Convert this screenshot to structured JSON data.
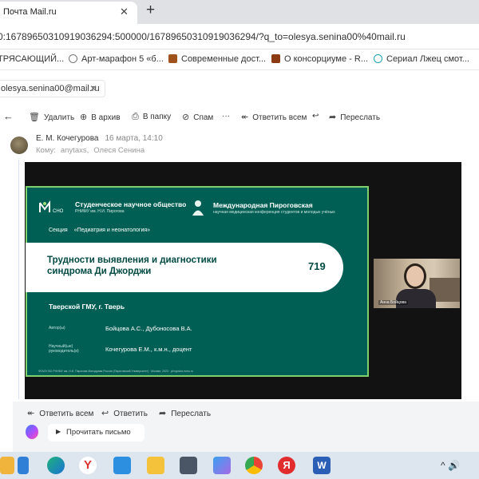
{
  "browser": {
    "tab_title": "Почта Mail.ru",
    "tab_close": "✕",
    "new_tab": "+",
    "address": "0:16789650310919036294:500000/16789650310919036294/?q_to=olesya.senina00%40mail.ru"
  },
  "bookmarks": [
    {
      "label": "ТРЯСАЮЩИЙ...",
      "icon": "bookmark-icon"
    },
    {
      "label": "Арт-марафон 5 «б...",
      "icon": "globe-icon"
    },
    {
      "label": "Современные дост...",
      "icon": "site-icon"
    },
    {
      "label": "О консорциуме - R...",
      "icon": "site-icon"
    },
    {
      "label": "Сериал Лжец смот...",
      "icon": "refresh-icon"
    }
  ],
  "account": {
    "email": "olesya.senina00@mail.ru",
    "close": "✕"
  },
  "toolbar": {
    "back": "←",
    "delete": "Удалить",
    "archive": "В архив",
    "move": "В папку",
    "spam": "Спам",
    "more": "···",
    "reply_all": "Ответить всем",
    "reply": "↩",
    "forward": "Переслать"
  },
  "message": {
    "sender": "Е. М. Кочегурова",
    "date": "16 марта, 14:10",
    "to_label": "Кому:",
    "to": [
      "anytaxs,",
      "Олеся Сенина"
    ]
  },
  "slide": {
    "org1_title": "Студенческое научное общество",
    "org1_sub": "РНИМУ им. Н.И. Пирогова",
    "org1_logo": "СНО",
    "org2_title": "Международная Пироговская",
    "org2_sub": "научная медицинская конференция студентов и молодых учёных",
    "section_label": "Секция",
    "section_value": "«Педиатрия и неонатология»",
    "title_line1": "Трудности выявления и диагностики",
    "title_line2": "синдрома Ди Джорджи",
    "number": "719",
    "institution": "Тверской ГМУ, г. Тверь",
    "authors_label": "Автор(ы)",
    "authors_value": "Бойцова А.С., Дубоносова В.А.",
    "supervisor_label": "Научный(ые) руководитель(и)",
    "supervisor_value": "Кочегурова Е.М., к.м.н., доцент",
    "footer": "ФГАОУ ВО РНИМУ им. Н.И. Пирогова Минздрава России (Пироговский Университет) · Москва, 2023 · pirogovka.rsmu.ru"
  },
  "camera": {
    "participant": "Анна Бойцова"
  },
  "replybar": {
    "reply_all": "Ответить всем",
    "reply": "Ответить",
    "forward": "Переслать",
    "read": "Прочитать письмо",
    "play": "▶"
  },
  "taskbar": {
    "apps": [
      "files-icon",
      "edge-icon",
      "yandex-browser-icon",
      "mail-icon",
      "explorer-icon",
      "calculator-icon",
      "photos-icon",
      "chrome-icon",
      "yandex-icon",
      "word-icon"
    ],
    "tray": "^ 🔊"
  },
  "colors": {
    "slide_bg": "#005f55",
    "slide_border": "#7fd06d",
    "accent_text": "#004a43"
  }
}
